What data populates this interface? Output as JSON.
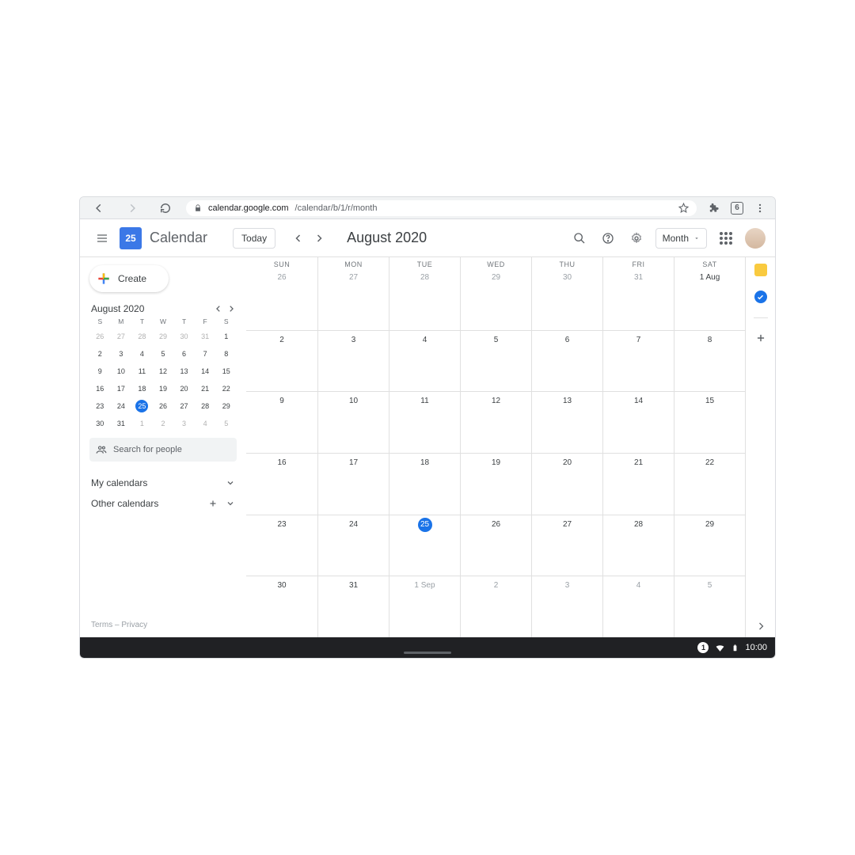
{
  "browser": {
    "url_host": "calendar.google.com",
    "url_path": "/calendar/b/1/r/month",
    "tab_count": "6"
  },
  "header": {
    "app_name": "Calendar",
    "logo_day": "25",
    "today_label": "Today",
    "current_period": "August 2020",
    "view_switcher_label": "Month"
  },
  "sidebar": {
    "create_label": "Create",
    "mini_title": "August 2020",
    "dow": [
      "S",
      "M",
      "T",
      "W",
      "T",
      "F",
      "S"
    ],
    "mini_days": [
      {
        "n": "26",
        "muted": true
      },
      {
        "n": "27",
        "muted": true
      },
      {
        "n": "28",
        "muted": true
      },
      {
        "n": "29",
        "muted": true
      },
      {
        "n": "30",
        "muted": true
      },
      {
        "n": "31",
        "muted": true
      },
      {
        "n": "1"
      },
      {
        "n": "2"
      },
      {
        "n": "3"
      },
      {
        "n": "4"
      },
      {
        "n": "5"
      },
      {
        "n": "6"
      },
      {
        "n": "7"
      },
      {
        "n": "8"
      },
      {
        "n": "9"
      },
      {
        "n": "10"
      },
      {
        "n": "11"
      },
      {
        "n": "12"
      },
      {
        "n": "13"
      },
      {
        "n": "14"
      },
      {
        "n": "15"
      },
      {
        "n": "16"
      },
      {
        "n": "17"
      },
      {
        "n": "18"
      },
      {
        "n": "19"
      },
      {
        "n": "20"
      },
      {
        "n": "21"
      },
      {
        "n": "22"
      },
      {
        "n": "23"
      },
      {
        "n": "24"
      },
      {
        "n": "25",
        "today": true
      },
      {
        "n": "26"
      },
      {
        "n": "27"
      },
      {
        "n": "28"
      },
      {
        "n": "29"
      },
      {
        "n": "30"
      },
      {
        "n": "31"
      },
      {
        "n": "1",
        "muted": true
      },
      {
        "n": "2",
        "muted": true
      },
      {
        "n": "3",
        "muted": true
      },
      {
        "n": "4",
        "muted": true
      },
      {
        "n": "5",
        "muted": true
      }
    ],
    "search_placeholder": "Search for people",
    "my_cal_label": "My calendars",
    "other_cal_label": "Other calendars",
    "terms_label": "Terms",
    "privacy_label": "Privacy"
  },
  "grid": {
    "dow": [
      "SUN",
      "MON",
      "TUE",
      "WED",
      "THU",
      "FRI",
      "SAT"
    ],
    "weeks": [
      [
        {
          "n": "26",
          "muted": true
        },
        {
          "n": "27",
          "muted": true
        },
        {
          "n": "28",
          "muted": true
        },
        {
          "n": "29",
          "muted": true
        },
        {
          "n": "30",
          "muted": true
        },
        {
          "n": "31",
          "muted": true
        },
        {
          "n": "1 Aug"
        }
      ],
      [
        {
          "n": "2"
        },
        {
          "n": "3"
        },
        {
          "n": "4"
        },
        {
          "n": "5"
        },
        {
          "n": "6"
        },
        {
          "n": "7"
        },
        {
          "n": "8"
        }
      ],
      [
        {
          "n": "9"
        },
        {
          "n": "10"
        },
        {
          "n": "11"
        },
        {
          "n": "12"
        },
        {
          "n": "13"
        },
        {
          "n": "14"
        },
        {
          "n": "15"
        }
      ],
      [
        {
          "n": "16"
        },
        {
          "n": "17"
        },
        {
          "n": "18"
        },
        {
          "n": "19"
        },
        {
          "n": "20"
        },
        {
          "n": "21"
        },
        {
          "n": "22"
        }
      ],
      [
        {
          "n": "23"
        },
        {
          "n": "24"
        },
        {
          "n": "25",
          "today": true
        },
        {
          "n": "26"
        },
        {
          "n": "27"
        },
        {
          "n": "28"
        },
        {
          "n": "29"
        }
      ],
      [
        {
          "n": "30"
        },
        {
          "n": "31"
        },
        {
          "n": "1 Sep",
          "muted": true
        },
        {
          "n": "2",
          "muted": true
        },
        {
          "n": "3",
          "muted": true
        },
        {
          "n": "4",
          "muted": true
        },
        {
          "n": "5",
          "muted": true
        }
      ]
    ]
  },
  "taskbar": {
    "badge": "1",
    "time": "10:00"
  }
}
